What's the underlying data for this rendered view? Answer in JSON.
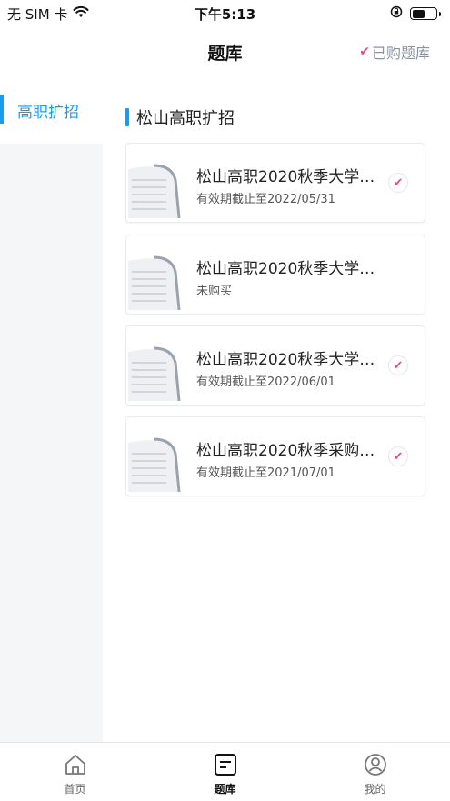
{
  "status_bar": {
    "carrier": "无 SIM 卡",
    "time": "下午5:13"
  },
  "nav": {
    "title": "题库",
    "purchased_label": "已购题库",
    "purchased_check": "✔"
  },
  "sidebar": {
    "items": [
      {
        "label": "高职扩招",
        "active": true
      }
    ]
  },
  "main": {
    "section_title": "松山高职扩招",
    "cards": [
      {
        "title": "松山高职2020秋季大学…",
        "subtitle": "有效期截止至2022/05/31",
        "purchased": true
      },
      {
        "title": "松山高职2020秋季大学…",
        "subtitle": "未购买",
        "purchased": false
      },
      {
        "title": "松山高职2020秋季大学…",
        "subtitle": "有效期截止至2022/06/01",
        "purchased": true
      },
      {
        "title": "松山高职2020秋季采购…",
        "subtitle": "有效期截止至2021/07/01",
        "purchased": true
      }
    ]
  },
  "tabs": [
    {
      "label": "首页",
      "icon": "home-icon",
      "active": false
    },
    {
      "label": "题库",
      "icon": "question-bank-icon",
      "active": true
    },
    {
      "label": "我的",
      "icon": "profile-icon",
      "active": false
    }
  ],
  "colors": {
    "accent": "#1a9bf0",
    "check": "#e84a7a",
    "sidebar_bg": "#f5f6f8"
  }
}
